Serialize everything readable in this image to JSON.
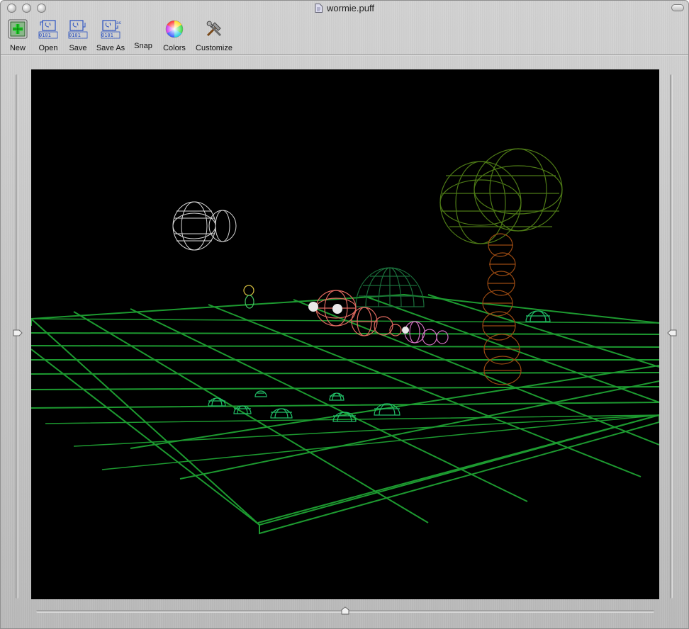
{
  "window": {
    "title": "wormie.puff"
  },
  "toolbar": {
    "items": [
      {
        "label": "New",
        "icon": "new-document-icon"
      },
      {
        "label": "Open",
        "icon": "open-binary-icon"
      },
      {
        "label": "Save",
        "icon": "save-binary-icon"
      },
      {
        "label": "Save As",
        "icon": "save-as-binary-icon"
      },
      {
        "label": "Snap",
        "icon": "snap-camera-icon"
      },
      {
        "label": "Colors",
        "icon": "color-wheel-icon"
      },
      {
        "label": "Customize",
        "icon": "tools-icon"
      }
    ]
  },
  "scene": {
    "background": "#000000",
    "grid_color": "#1d9a30",
    "objects": [
      "cloud",
      "worm",
      "tree",
      "dome",
      "small-mushrooms",
      "small-figure"
    ],
    "colors": {
      "cloud": "#d8d8d8",
      "worm_body": "#e06a60",
      "worm_tail": "#d070c0",
      "tree_canopy": "#4d7a16",
      "tree_trunk": "#9a4a12",
      "dome": "#1a6d3a",
      "mushroom": "#22c068",
      "figure_head": "#d8c040"
    }
  }
}
